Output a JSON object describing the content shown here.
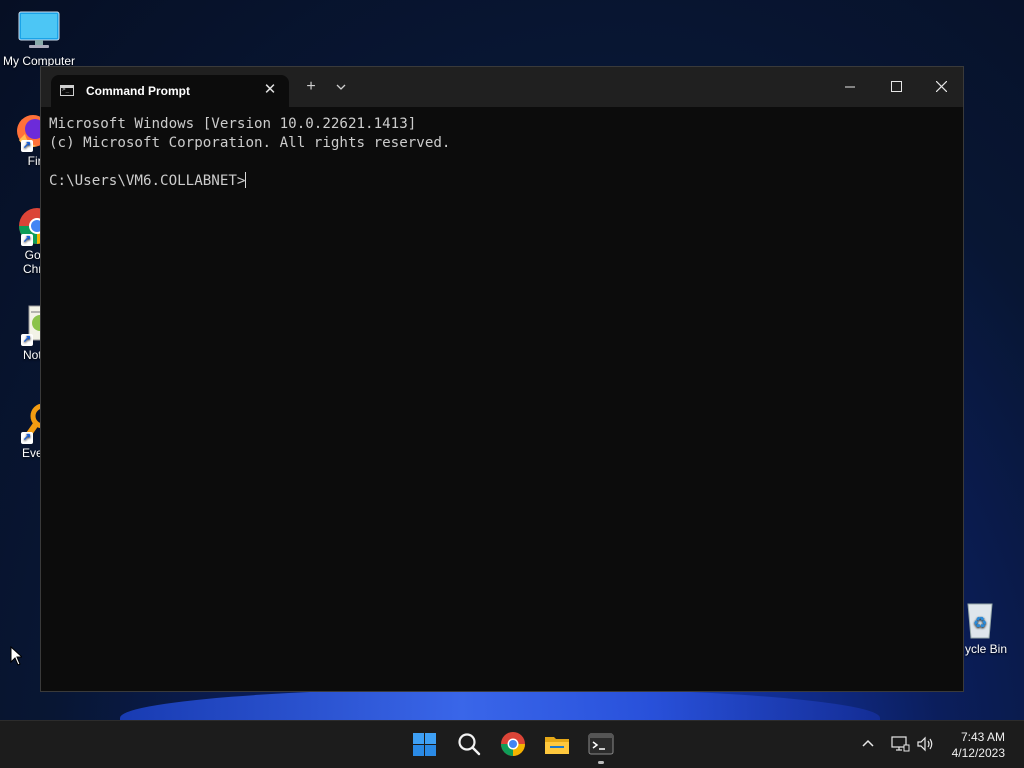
{
  "desktop": {
    "icons": [
      {
        "label": "My Computer"
      },
      {
        "label": "Fire"
      },
      {
        "label": "Goo",
        "label2": "Chro"
      },
      {
        "label": "Notep"
      },
      {
        "label": "Everyt"
      },
      {
        "label": "ycle Bin"
      }
    ]
  },
  "window": {
    "tab_title": "Command Prompt",
    "tab_close": "✕",
    "new_tab": "+",
    "dropdown": "⌄",
    "minimize": "—",
    "maximize": "☐",
    "close": "✕"
  },
  "console": {
    "line1": "Microsoft Windows [Version 10.0.22621.1413]",
    "line2": "(c) Microsoft Corporation. All rights reserved.",
    "prompt": "C:\\Users\\VM6.COLLABNET>"
  },
  "taskbar": {
    "pinned": [
      "start-icon",
      "search-icon",
      "chrome-icon",
      "file-explorer-icon",
      "terminal-icon"
    ],
    "tray_chevron": "⌃",
    "time": "7:43 AM",
    "date": "4/12/2023"
  },
  "colors": {
    "console_bg": "#0c0c0c",
    "console_text": "#cccccc",
    "titlebar": "#202020",
    "taskbar": "#1c1c1c",
    "accent": "#0078d4"
  }
}
